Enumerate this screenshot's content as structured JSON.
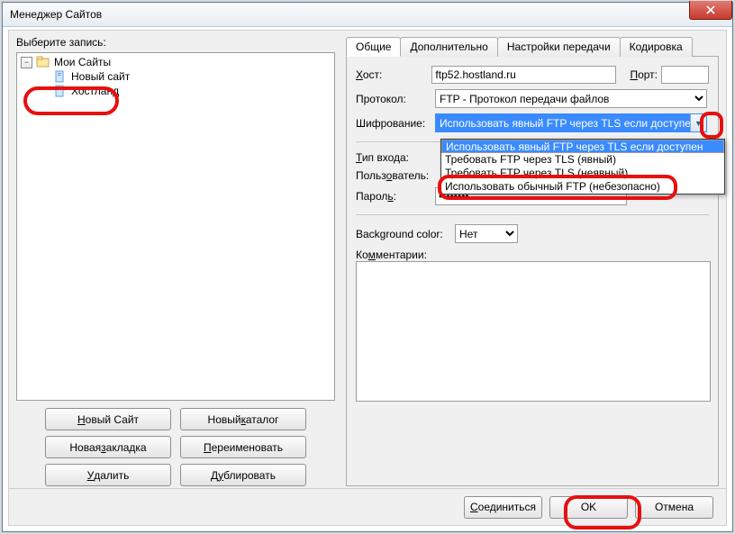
{
  "window": {
    "title": "Менеджер Сайтов"
  },
  "left": {
    "label": "Выберите запись:",
    "root": "Мои Сайты",
    "items": [
      "Новый сайт",
      "Хостланд"
    ],
    "buttons": {
      "new_site": "Новый Сайт",
      "new_folder": "Новый каталог",
      "new_bookmark": "Новая закладка",
      "rename": "Переименовать",
      "delete": "Удалить",
      "duplicate": "Дублировать"
    }
  },
  "tabs": [
    "Общие",
    "Дополнительно",
    "Настройки передачи",
    "Кодировка"
  ],
  "fields": {
    "host_label": "Хост:",
    "host_value": "ftp52.hostland.ru",
    "port_label": "Порт:",
    "port_value": "",
    "protocol_label": "Протокол:",
    "protocol_value": "FTP - Протокол передачи файлов",
    "encryption_label": "Шифрование:",
    "encryption_value": "Использовать явный FTP через TLS если доступен",
    "encryption_options": [
      "Использовать явный FTP через TLS если доступен",
      "Требовать FTP через TLS (явный)",
      "Требовать FTP через TLS (неявный)",
      "Использовать обычный FTP (небезопасно)"
    ],
    "logon_label": "Тип входа:",
    "user_label": "Пользователь:",
    "password_label": "Пароль:",
    "password_value": "••••••••",
    "bgcolor_label": "Background color:",
    "bgcolor_value": "Нет",
    "comments_label": "Комментарии:"
  },
  "bottom": {
    "connect": "Соединиться",
    "ok": "OK",
    "cancel": "Отмена"
  }
}
